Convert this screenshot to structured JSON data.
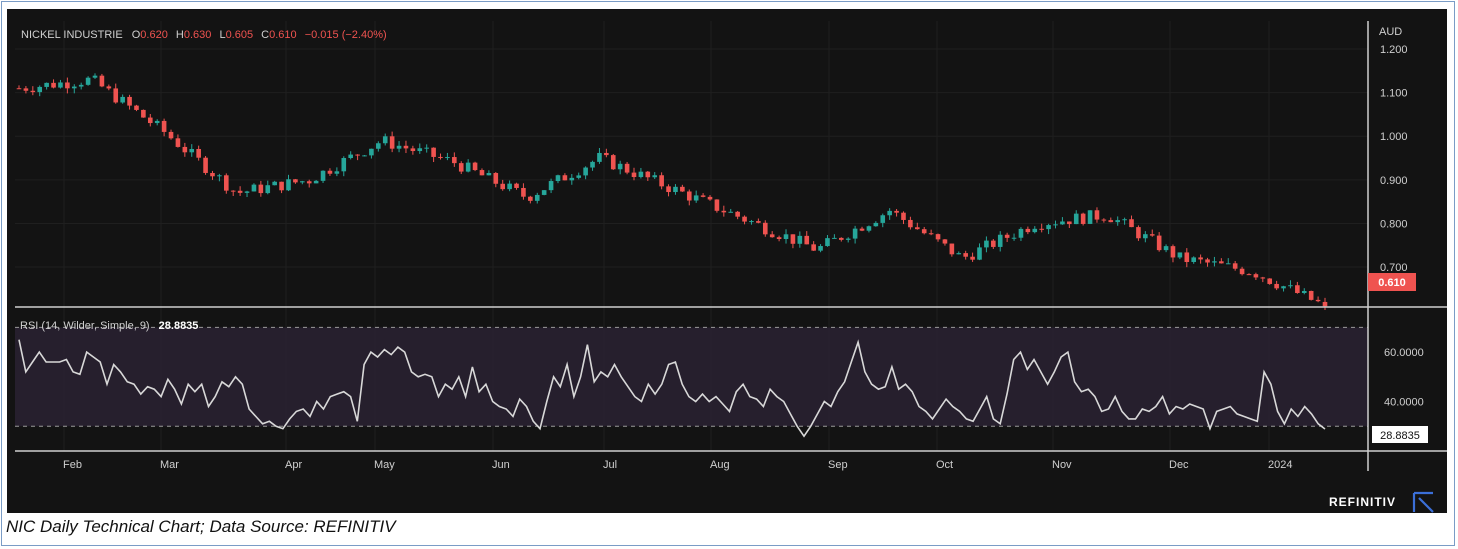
{
  "header": {
    "symbol": "NICKEL INDUSTRIE",
    "o_label": "O",
    "o_value": "0.620",
    "h_label": "H",
    "h_value": "0.630",
    "l_label": "L",
    "l_value": "0.605",
    "c_label": "C",
    "c_value": "0.610",
    "change": "−0.015 (−2.40%)"
  },
  "currency": "AUD",
  "last_price_badge": "0.610",
  "rsi_header": {
    "label": "RSI (14, Wilder, Simple, 9)",
    "value": "28.8835"
  },
  "rsi_badge": "28.8835",
  "brand": "REFINITIV",
  "caption": "NIC Daily Technical Chart; Data Source: REFINITIV",
  "colors": {
    "up": "#26a69a",
    "down": "#ef5350",
    "bg": "#131313",
    "rsi_line": "#d8d8d8",
    "rsi_band": "#2a2233",
    "badge_red": "#ef5350"
  },
  "chart_data": [
    {
      "type": "candlestick",
      "title": "NICKEL INDUSTRIE",
      "ylabel": "AUD",
      "ylim": [
        0.6,
        1.2
      ],
      "y_ticks": [
        "1.200",
        "1.100",
        "1.000",
        "0.900",
        "0.800",
        "0.700"
      ],
      "x_ticks": [
        "Feb",
        "Mar",
        "Apr",
        "May",
        "Jun",
        "Jul",
        "Aug",
        "Sep",
        "Oct",
        "Nov",
        "Dec",
        "2024"
      ],
      "close_path_approx": [
        {
          "date": "Jan",
          "close": 1.11
        },
        {
          "date": "Feb",
          "close": 1.13
        },
        {
          "date": "Mar",
          "close": 1.01
        },
        {
          "date": "mid-Mar",
          "close": 0.87
        },
        {
          "date": "Apr",
          "close": 0.9
        },
        {
          "date": "mid-Apr",
          "close": 0.99
        },
        {
          "date": "May",
          "close": 0.94
        },
        {
          "date": "Jun",
          "close": 0.86
        },
        {
          "date": "mid-Jun",
          "close": 0.95
        },
        {
          "date": "Jul",
          "close": 0.88
        },
        {
          "date": "Aug",
          "close": 0.81
        },
        {
          "date": "late-Aug",
          "close": 0.74
        },
        {
          "date": "Sep",
          "close": 0.83
        },
        {
          "date": "Oct",
          "close": 0.72
        },
        {
          "date": "mid-Oct",
          "close": 0.8
        },
        {
          "date": "Nov",
          "close": 0.82
        },
        {
          "date": "Dec",
          "close": 0.72
        },
        {
          "date": "2024",
          "close": 0.69
        },
        {
          "date": "Jan-2024",
          "close": 0.61
        }
      ],
      "last": 0.61
    },
    {
      "type": "line",
      "title": "RSI (14, Wilder, Simple, 9)",
      "ylim": [
        20,
        75
      ],
      "y_ticks": [
        "60.0000",
        "40.0000"
      ],
      "reference_lines": [
        70,
        30
      ],
      "values": [
        65,
        52,
        56,
        60,
        56,
        56,
        56,
        57,
        52,
        51,
        60,
        58,
        56,
        47,
        55,
        52,
        48,
        47,
        43,
        46,
        45,
        42,
        49,
        45,
        39,
        47,
        44,
        47,
        38,
        42,
        48,
        46,
        50,
        47,
        37,
        34,
        31,
        32,
        30,
        29,
        33,
        36,
        37,
        34,
        40,
        37,
        42,
        43,
        44,
        42,
        32,
        55,
        60,
        58,
        61,
        59,
        62,
        60,
        52,
        50,
        51,
        50,
        42,
        47,
        45,
        50,
        42,
        54,
        44,
        47,
        40,
        38,
        37,
        34,
        41,
        38,
        32,
        29,
        40,
        50,
        46,
        55,
        42,
        50,
        63,
        48,
        52,
        50,
        55,
        50,
        46,
        42,
        40,
        47,
        43,
        47,
        55,
        56,
        47,
        42,
        40,
        43,
        40,
        42,
        39,
        36,
        44,
        47,
        42,
        41,
        38,
        45,
        42,
        40,
        35,
        30,
        26,
        30,
        35,
        40,
        38,
        44,
        48,
        56,
        64,
        52,
        47,
        45,
        46,
        54,
        45,
        47,
        44,
        38,
        36,
        33,
        37,
        41,
        38,
        36,
        33,
        32,
        37,
        42,
        33,
        31,
        43,
        57,
        60,
        53,
        57,
        52,
        47,
        52,
        58,
        60,
        48,
        44,
        45,
        42,
        36,
        37,
        42,
        36,
        33,
        33,
        37,
        36,
        38,
        42,
        35,
        38,
        37,
        39,
        38,
        37,
        29,
        36,
        37,
        38,
        35,
        34,
        33,
        32,
        52,
        47,
        36,
        31,
        37,
        34,
        38,
        35,
        31,
        28.8835
      ],
      "last": 28.8835
    }
  ]
}
